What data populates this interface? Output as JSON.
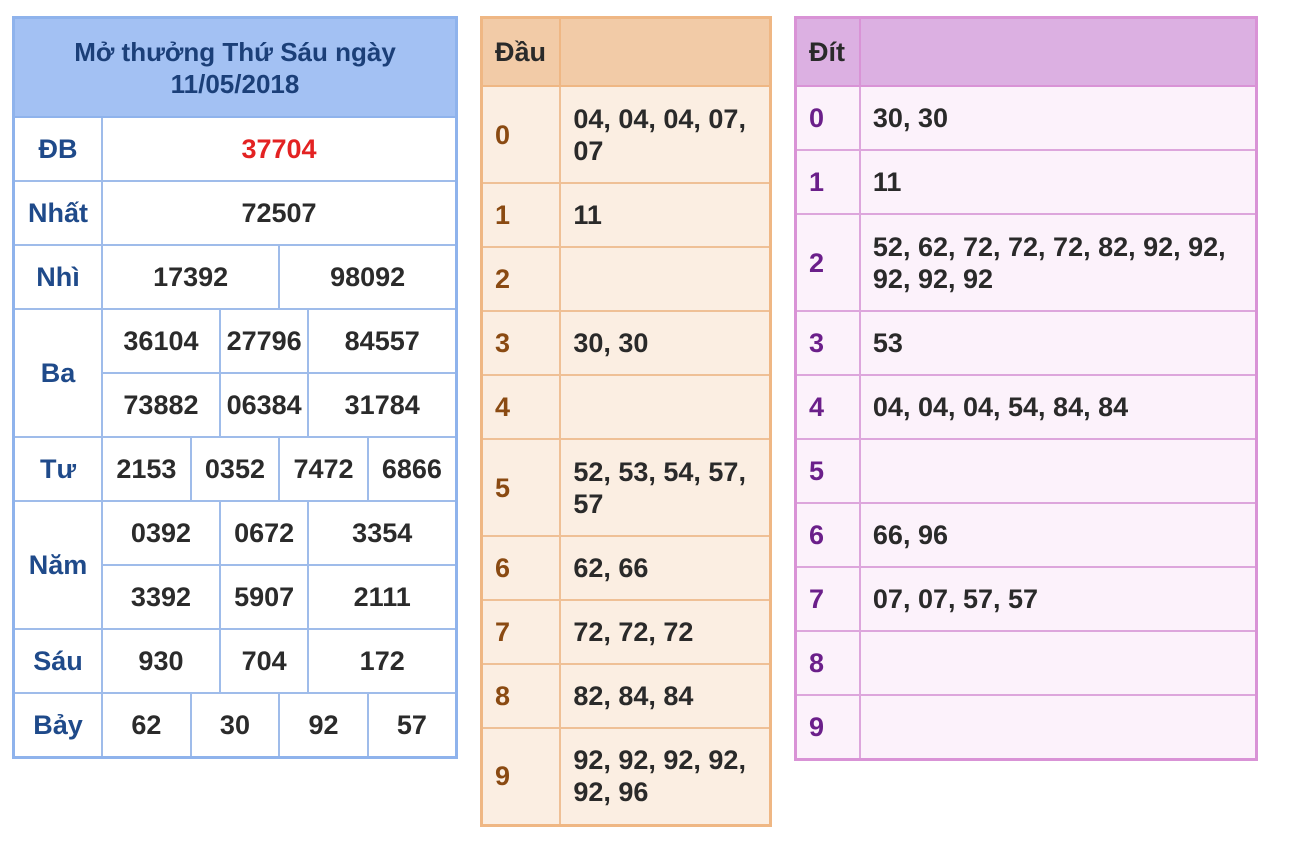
{
  "results": {
    "title": "Mở thưởng Thứ Sáu ngày 11/05/2018",
    "prizes": [
      {
        "label": "ĐB",
        "values": [
          "37704"
        ]
      },
      {
        "label": "Nhất",
        "values": [
          "72507"
        ]
      },
      {
        "label": "Nhì",
        "values": [
          "17392",
          "98092"
        ]
      },
      {
        "label": "Ba",
        "values": [
          "36104",
          "27796",
          "84557",
          "73882",
          "06384",
          "31784"
        ]
      },
      {
        "label": "Tư",
        "values": [
          "2153",
          "0352",
          "7472",
          "6866"
        ]
      },
      {
        "label": "Năm",
        "values": [
          "0392",
          "0672",
          "3354",
          "3392",
          "5907",
          "2111"
        ]
      },
      {
        "label": "Sáu",
        "values": [
          "930",
          "704",
          "172"
        ]
      },
      {
        "label": "Bảy",
        "values": [
          "62",
          "30",
          "92",
          "57"
        ]
      }
    ]
  },
  "dau": {
    "header": "Đầu",
    "rows": [
      {
        "key": "0",
        "value": "04, 04, 04, 07, 07"
      },
      {
        "key": "1",
        "value": "11"
      },
      {
        "key": "2",
        "value": ""
      },
      {
        "key": "3",
        "value": "30, 30"
      },
      {
        "key": "4",
        "value": ""
      },
      {
        "key": "5",
        "value": "52, 53, 54, 57, 57"
      },
      {
        "key": "6",
        "value": "62, 66"
      },
      {
        "key": "7",
        "value": "72, 72, 72"
      },
      {
        "key": "8",
        "value": "82, 84, 84"
      },
      {
        "key": "9",
        "value": "92, 92, 92, 92, 92, 96"
      }
    ]
  },
  "dit": {
    "header": "Đít",
    "rows": [
      {
        "key": "0",
        "value": "30, 30"
      },
      {
        "key": "1",
        "value": "11"
      },
      {
        "key": "2",
        "value": "52, 62, 72, 72, 72, 82, 92, 92, 92, 92, 92"
      },
      {
        "key": "3",
        "value": "53"
      },
      {
        "key": "4",
        "value": "04, 04, 04, 54, 84, 84"
      },
      {
        "key": "5",
        "value": ""
      },
      {
        "key": "6",
        "value": "66, 96"
      },
      {
        "key": "7",
        "value": "07, 07, 57, 57"
      },
      {
        "key": "8",
        "value": ""
      },
      {
        "key": "9",
        "value": ""
      }
    ]
  },
  "colors": {
    "special_prize": "#e32222",
    "results_header": "#a3c1f3",
    "dau_header": "#f2cba7",
    "dit_header": "#dcb0e2"
  }
}
